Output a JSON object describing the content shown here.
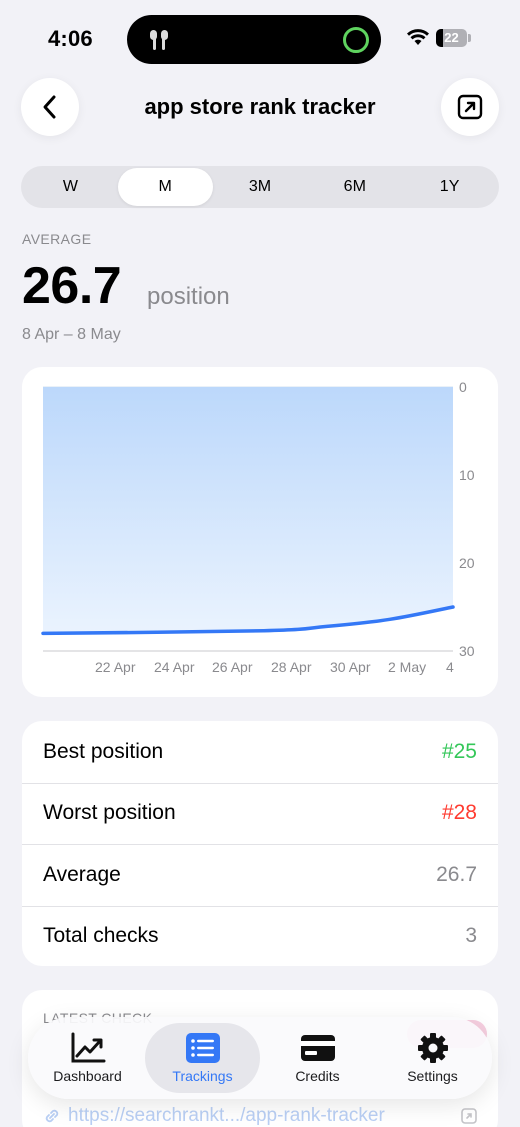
{
  "status_bar": {
    "time": "4:06",
    "battery": "22"
  },
  "header": {
    "title": "app store rank tracker"
  },
  "segments": [
    {
      "label": "W",
      "active": false
    },
    {
      "label": "M",
      "active": true
    },
    {
      "label": "3M",
      "active": false
    },
    {
      "label": "6M",
      "active": false
    },
    {
      "label": "1Y",
      "active": false
    }
  ],
  "summary": {
    "label": "AVERAGE",
    "value": "26.7",
    "unit": "position",
    "range": "8 Apr – 8 May"
  },
  "chart_data": {
    "type": "area",
    "x": [
      "2024-04-08",
      "2024-04-22",
      "2024-04-26",
      "2024-04-30",
      "2024-05-04"
    ],
    "y_axis_reversed": true,
    "ylim": [
      0,
      30
    ],
    "y_ticks": [
      "0",
      "10",
      "20",
      "30"
    ],
    "x_ticks": [
      "22 Apr",
      "24 Apr",
      "26 Apr",
      "28 Apr",
      "30 Apr",
      "2 May",
      "4"
    ],
    "series": [
      {
        "values": [
          28,
          27.7,
          27.2,
          26.4,
          25
        ]
      }
    ],
    "line_color": "#3478f6",
    "fill_color": "#bcd8fb"
  },
  "stats": [
    {
      "label": "Best position",
      "value": "#25",
      "color": "#34c759"
    },
    {
      "label": "Worst position",
      "value": "#28",
      "color": "#ff3b30"
    },
    {
      "label": "Average",
      "value": "26.7",
      "color": "#8a8a8e"
    },
    {
      "label": "Total checks",
      "value": "3",
      "color": "#8a8a8e"
    }
  ],
  "latest": {
    "label": "LATEST CHECK",
    "link": "https://searchrankt.../app-rank-tracker"
  },
  "tabbar": [
    {
      "label": "Dashboard",
      "icon": "chart-line-icon",
      "active": false
    },
    {
      "label": "Trackings",
      "icon": "list-icon",
      "active": true
    },
    {
      "label": "Credits",
      "icon": "credit-card-icon",
      "active": false
    },
    {
      "label": "Settings",
      "icon": "gear-icon",
      "active": false
    }
  ]
}
